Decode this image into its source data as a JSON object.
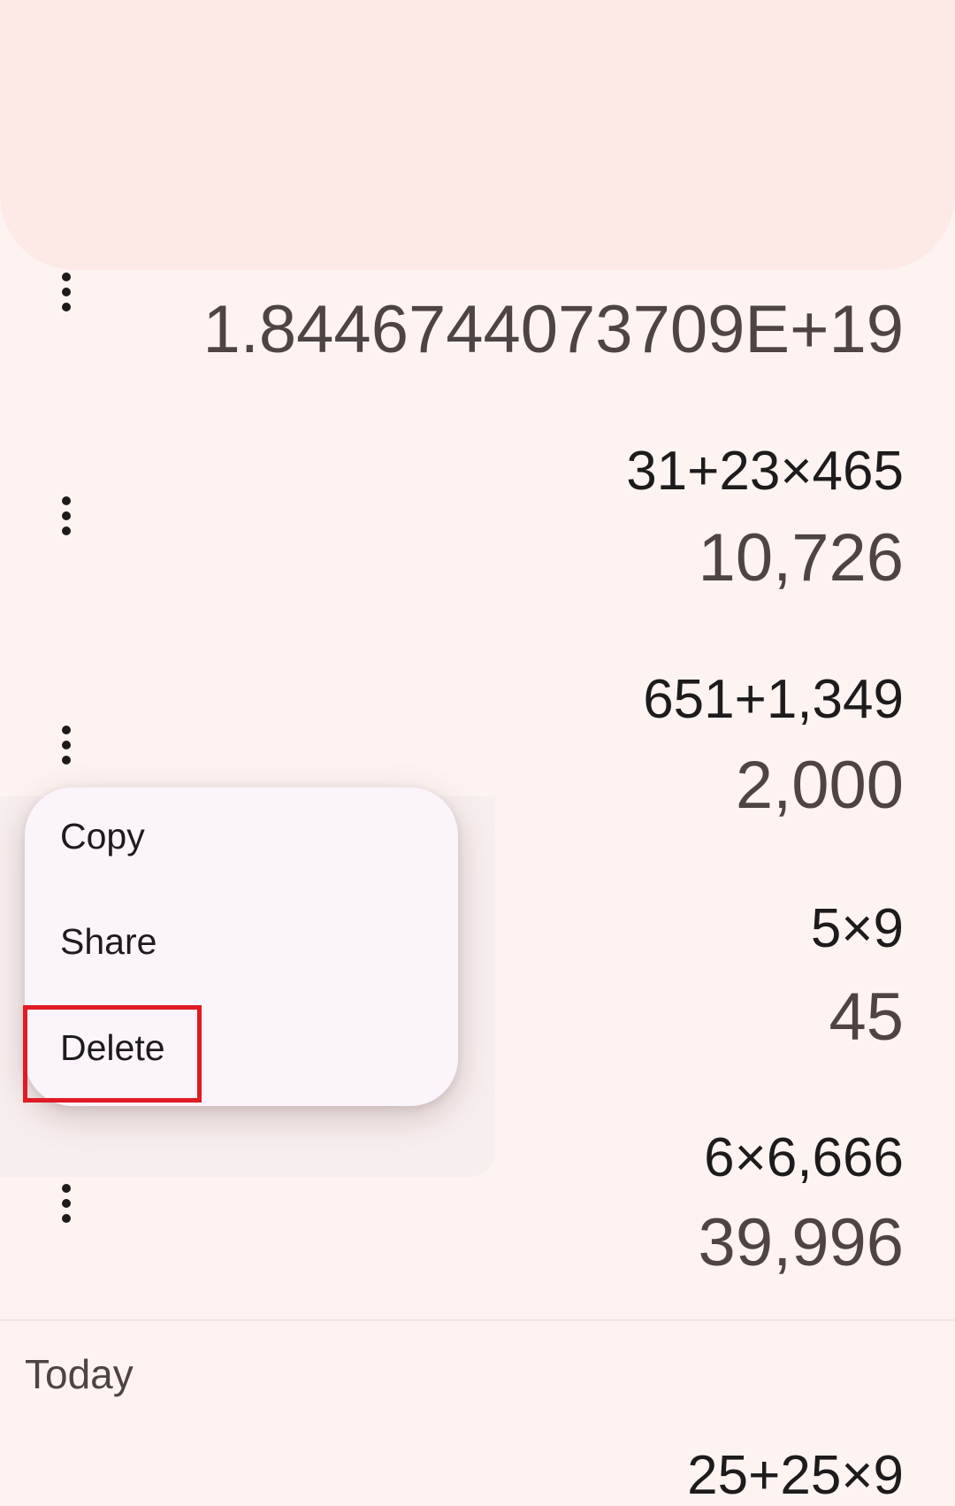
{
  "history": {
    "entries": [
      {
        "expression": "",
        "result": "1.8446744073709E+19"
      },
      {
        "expression": "31+23×465",
        "result": "10,726"
      },
      {
        "expression": "651+1,349",
        "result": "2,000"
      },
      {
        "expression": "5×9",
        "result": "45"
      },
      {
        "expression": "6×6,666",
        "result": "39,996"
      }
    ],
    "section_label": "Today",
    "next_entry_expression": "25+25×9"
  },
  "context_menu": {
    "items": [
      {
        "label": "Copy"
      },
      {
        "label": "Share"
      },
      {
        "label": "Delete"
      }
    ]
  },
  "icons": {
    "more": "more-vert-icon"
  },
  "colors": {
    "background": "#fdf4f2",
    "top_panel": "#fde9e6",
    "menu_background": "#fcf4fb",
    "highlight": "#e01b24"
  }
}
